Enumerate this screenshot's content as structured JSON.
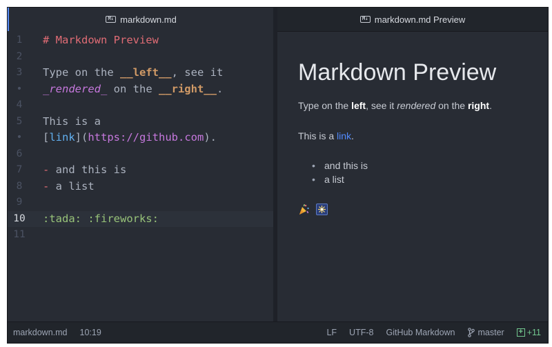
{
  "editor": {
    "tab_label": "markdown.md",
    "tab_icon": "markdown-icon",
    "lines": [
      {
        "num": "1",
        "parts": [
          {
            "t": "# Markdown Preview",
            "c": "c-heading"
          }
        ]
      },
      {
        "num": "2",
        "parts": []
      },
      {
        "num": "3",
        "parts": [
          {
            "t": "Type on the ",
            "c": "c-plain"
          },
          {
            "t": "__left__",
            "c": "c-bold"
          },
          {
            "t": ", see it",
            "c": "c-plain"
          }
        ]
      },
      {
        "num": "•",
        "parts": [
          {
            "t": "_rendered_",
            "c": "c-italic"
          },
          {
            "t": " on the ",
            "c": "c-plain"
          },
          {
            "t": "__right__",
            "c": "c-bold"
          },
          {
            "t": ".",
            "c": "c-plain"
          }
        ]
      },
      {
        "num": "4",
        "parts": []
      },
      {
        "num": "5",
        "parts": [
          {
            "t": "This is a",
            "c": "c-plain"
          }
        ]
      },
      {
        "num": "•",
        "parts": [
          {
            "t": "[",
            "c": "c-bracket"
          },
          {
            "t": "link",
            "c": "c-link-text"
          },
          {
            "t": "](",
            "c": "c-bracket"
          },
          {
            "t": "https://github.com",
            "c": "c-url"
          },
          {
            "t": ").",
            "c": "c-bracket"
          }
        ]
      },
      {
        "num": "6",
        "parts": []
      },
      {
        "num": "7",
        "parts": [
          {
            "t": "- ",
            "c": "c-list"
          },
          {
            "t": "and this is",
            "c": "c-plain"
          }
        ]
      },
      {
        "num": "8",
        "parts": [
          {
            "t": "- ",
            "c": "c-list"
          },
          {
            "t": "a list",
            "c": "c-plain"
          }
        ]
      },
      {
        "num": "9",
        "parts": []
      },
      {
        "num": "10",
        "current": true,
        "parts": [
          {
            "t": ":tada: :fireworks:",
            "c": "c-emoji"
          }
        ]
      },
      {
        "num": "11",
        "parts": []
      }
    ]
  },
  "preview": {
    "tab_label": "markdown.md Preview",
    "tab_icon": "markdown-icon",
    "title": "Markdown Preview",
    "p1": {
      "a": "Type on the ",
      "b": "left",
      "c": ", see it ",
      "d": "rendered",
      "e": " on the ",
      "f": "right",
      "g": "."
    },
    "p2": {
      "a": "This is a ",
      "link": "link",
      "end": "."
    },
    "list": [
      "and this is",
      "a list"
    ],
    "emoji": [
      "tada-icon",
      "fireworks-icon"
    ]
  },
  "status_bar": {
    "file": "markdown.md",
    "cursor": "10:19",
    "line_ending": "LF",
    "encoding": "UTF-8",
    "grammar": "GitHub Markdown",
    "branch": "master",
    "diff": "+11",
    "branch_icon": "git-branch-icon",
    "diff_icon": "git-diff-icon"
  },
  "colors": {
    "accent": "#568af2",
    "heading": "#e06c75",
    "bold": "#d19a66",
    "italic": "#c678dd",
    "link": "#61afef",
    "emoji": "#98c379",
    "diff": "#73c990"
  }
}
